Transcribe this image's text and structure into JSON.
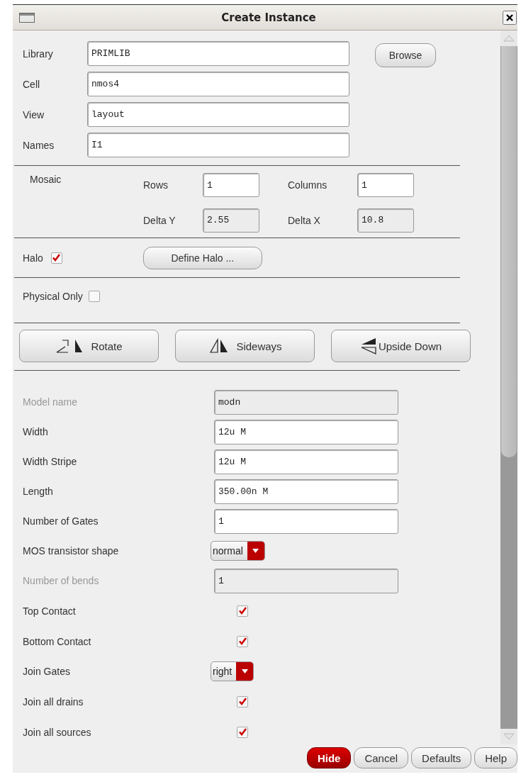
{
  "window": {
    "title": "Create Instance"
  },
  "top_fields": [
    {
      "label": "Library",
      "value": "PRIMLIB"
    },
    {
      "label": "Cell",
      "value": "nmos4"
    },
    {
      "label": "View",
      "value": "layout"
    },
    {
      "label": "Names",
      "value": "I1"
    }
  ],
  "browse_button": "Browse",
  "mosaic": {
    "label": "Mosaic",
    "fields": [
      {
        "label": "Rows",
        "value": "1",
        "disabled": false
      },
      {
        "label": "Columns",
        "value": "1",
        "disabled": false
      },
      {
        "label": "Delta Y",
        "value": "2.55",
        "disabled": true
      },
      {
        "label": "Delta X",
        "value": "10.8",
        "disabled": true
      }
    ]
  },
  "halo": {
    "label": "Halo",
    "checked": true,
    "button": "Define Halo ..."
  },
  "physical_only": {
    "label": "Physical Only",
    "checked": false
  },
  "orient_buttons": [
    {
      "kind": "rotate",
      "label": "Rotate"
    },
    {
      "kind": "sideways",
      "label": "Sideways"
    },
    {
      "kind": "upside",
      "label": "Upside Down"
    }
  ],
  "parameters": [
    {
      "kind": "field",
      "label": "Model name",
      "value": "modn",
      "disabled": true
    },
    {
      "kind": "field",
      "label": "Width",
      "value": "12u M",
      "disabled": false
    },
    {
      "kind": "field",
      "label": "Width Stripe",
      "value": "12u M",
      "disabled": false
    },
    {
      "kind": "field",
      "label": "Length",
      "value": "350.00n M",
      "disabled": false
    },
    {
      "kind": "field",
      "label": "Number of Gates",
      "value": "1",
      "disabled": false
    },
    {
      "kind": "dropdown",
      "label": "MOS transistor shape",
      "value": "normal"
    },
    {
      "kind": "field",
      "label": "Number of bends",
      "value": "1",
      "disabled": true
    },
    {
      "kind": "checkbox",
      "label": "Top Contact",
      "checked": true
    },
    {
      "kind": "checkbox",
      "label": "Bottom Contact",
      "checked": true
    },
    {
      "kind": "dropdown",
      "label": "Join Gates",
      "value": "right"
    },
    {
      "kind": "checkbox",
      "label": "Join all drains",
      "checked": true
    },
    {
      "kind": "checkbox",
      "label": "Join all sources",
      "checked": true
    }
  ],
  "footer_buttons": [
    {
      "label": "Hide",
      "primary": true
    },
    {
      "label": "Cancel",
      "primary": false
    },
    {
      "label": "Defaults",
      "primary": false
    },
    {
      "label": "Help",
      "primary": false
    }
  ]
}
